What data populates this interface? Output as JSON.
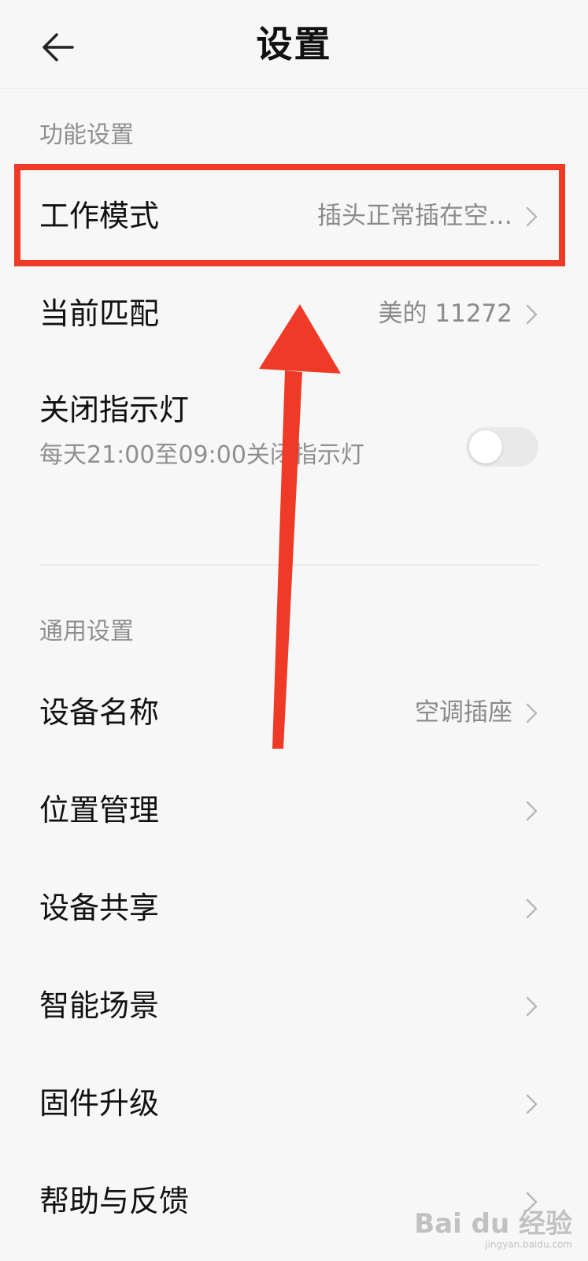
{
  "header": {
    "title": "设置",
    "back_icon": "arrow-left-icon"
  },
  "sections": {
    "function": {
      "title": "功能设置",
      "rows": [
        {
          "label": "工作模式",
          "value": "插头正常插在空…"
        },
        {
          "label": "当前匹配",
          "value": "美的 11272"
        }
      ],
      "toggle": {
        "title": "关闭指示灯",
        "description": "每天21:00至09:00关闭指示灯",
        "checked": false
      }
    },
    "general": {
      "title": "通用设置",
      "rows": [
        {
          "label": "设备名称",
          "value": "空调插座"
        },
        {
          "label": "位置管理",
          "value": ""
        },
        {
          "label": "设备共享",
          "value": ""
        },
        {
          "label": "智能场景",
          "value": ""
        },
        {
          "label": "固件升级",
          "value": ""
        },
        {
          "label": "帮助与反馈",
          "value": ""
        }
      ]
    }
  },
  "annotation": {
    "highlight_color": "#ee3a26",
    "arrow_color": "#ee3a26"
  },
  "watermark": {
    "logo": "Bai du 经验",
    "url": "jingyan.baidu.com"
  },
  "colors": {
    "background": "#f7f7f7",
    "text_primary": "#111111",
    "text_secondary": "#8f8f8f",
    "toggle_off": "#e9e9e9"
  }
}
